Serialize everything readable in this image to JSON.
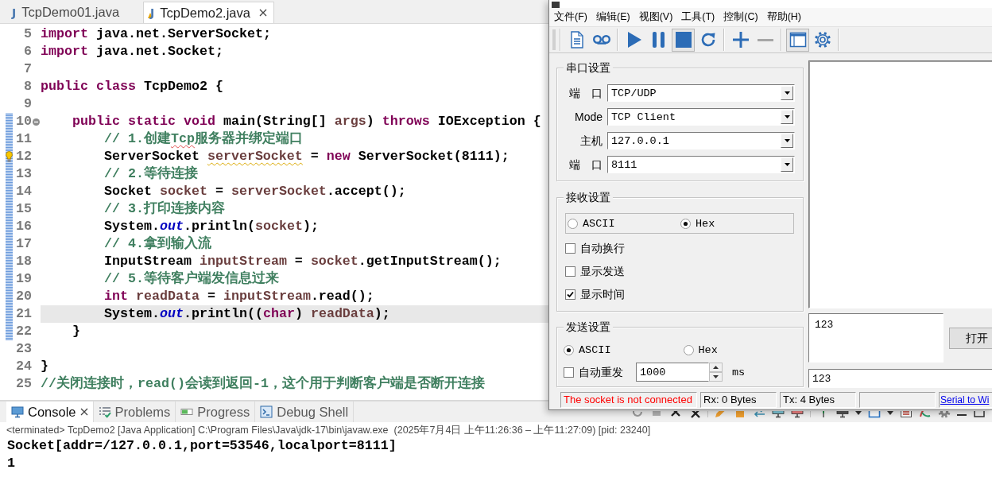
{
  "editor": {
    "tabs": [
      {
        "icon": "J",
        "label": "TcpDemo01.java",
        "selected": false,
        "warning": false
      },
      {
        "icon": "J",
        "label": "TcpDemo2.java",
        "selected": true,
        "warning": true
      }
    ],
    "lines": [
      {
        "number": "5",
        "changed": false,
        "current": false,
        "foldable": false,
        "quick_fix": false,
        "segments": [
          {
            "kind": "keyword",
            "text": "import"
          },
          {
            "kind": "plain",
            "text": " java.net.ServerSocket;"
          }
        ]
      },
      {
        "number": "6",
        "changed": false,
        "current": false,
        "foldable": false,
        "quick_fix": false,
        "segments": [
          {
            "kind": "keyword",
            "text": "import"
          },
          {
            "kind": "plain",
            "text": " java.net.Socket;"
          }
        ]
      },
      {
        "number": "7",
        "changed": false,
        "current": false,
        "foldable": false,
        "quick_fix": false
      },
      {
        "number": "8",
        "changed": false,
        "current": false,
        "foldable": false,
        "quick_fix": false,
        "segments": [
          {
            "kind": "keyword",
            "text": "public class"
          },
          {
            "kind": "plain",
            "text": " TcpDemo2 {"
          }
        ]
      },
      {
        "number": "9",
        "changed": false,
        "current": false,
        "foldable": false,
        "quick_fix": false
      },
      {
        "number": "10",
        "changed": true,
        "current": false,
        "foldable": true,
        "quick_fix": false,
        "segments": [
          {
            "kind": "keyword",
            "text": "    public static void"
          },
          {
            "kind": "plain",
            "text": " main(String[] "
          },
          {
            "kind": "local",
            "text": "args"
          },
          {
            "kind": "plain",
            "text": ") "
          },
          {
            "kind": "keyword",
            "text": "throws"
          },
          {
            "kind": "plain",
            "text": " IOException {"
          }
        ]
      },
      {
        "number": "11",
        "changed": true,
        "current": false,
        "foldable": false,
        "quick_fix": false,
        "segments": [
          {
            "kind": "comment",
            "text": "        // 1.创建"
          },
          {
            "kind": "misspelled",
            "text": "Tcp"
          },
          {
            "kind": "comment",
            "text": "服务器并绑定端口"
          }
        ]
      },
      {
        "number": "12",
        "changed": true,
        "current": false,
        "foldable": false,
        "quick_fix": true,
        "segments": [
          {
            "kind": "plain",
            "text": "        ServerSocket "
          },
          {
            "kind": "unused",
            "text": "serverSocket"
          },
          {
            "kind": "plain",
            "text": " = "
          },
          {
            "kind": "keyword",
            "text": "new"
          },
          {
            "kind": "plain",
            "text": " ServerSocket(8111);"
          }
        ]
      },
      {
        "number": "13",
        "changed": true,
        "current": false,
        "foldable": false,
        "quick_fix": false,
        "segments": [
          {
            "kind": "comment",
            "text": "        // 2.等待连接"
          }
        ]
      },
      {
        "number": "14",
        "changed": true,
        "current": false,
        "foldable": false,
        "quick_fix": false,
        "segments": [
          {
            "kind": "plain",
            "text": "        Socket "
          },
          {
            "kind": "local",
            "text": "socket"
          },
          {
            "kind": "plain",
            "text": " = "
          },
          {
            "kind": "local",
            "text": "serverSocket"
          },
          {
            "kind": "plain",
            "text": ".accept();"
          }
        ]
      },
      {
        "number": "15",
        "changed": true,
        "current": false,
        "foldable": false,
        "quick_fix": false,
        "segments": [
          {
            "kind": "comment",
            "text": "        // 3.打印连接内容"
          }
        ]
      },
      {
        "number": "16",
        "changed": true,
        "current": false,
        "foldable": false,
        "quick_fix": false,
        "segments": [
          {
            "kind": "plain",
            "text": "        System."
          },
          {
            "kind": "field",
            "text": "out"
          },
          {
            "kind": "plain",
            "text": ".println("
          },
          {
            "kind": "local",
            "text": "socket"
          },
          {
            "kind": "plain",
            "text": ");"
          }
        ]
      },
      {
        "number": "17",
        "changed": true,
        "current": false,
        "foldable": false,
        "quick_fix": false,
        "segments": [
          {
            "kind": "comment",
            "text": "        // 4.拿到输入流"
          }
        ]
      },
      {
        "number": "18",
        "changed": true,
        "current": false,
        "foldable": false,
        "quick_fix": false,
        "segments": [
          {
            "kind": "plain",
            "text": "        InputStream "
          },
          {
            "kind": "local",
            "text": "inputStream"
          },
          {
            "kind": "plain",
            "text": " = "
          },
          {
            "kind": "local",
            "text": "socket"
          },
          {
            "kind": "plain",
            "text": ".getInputStream();"
          }
        ]
      },
      {
        "number": "19",
        "changed": true,
        "current": false,
        "foldable": false,
        "quick_fix": false,
        "segments": [
          {
            "kind": "comment",
            "text": "        // 5.等待客户端发信息过来"
          }
        ]
      },
      {
        "number": "20",
        "changed": true,
        "current": false,
        "foldable": false,
        "quick_fix": false,
        "segments": [
          {
            "kind": "keyword",
            "text": "        int"
          },
          {
            "kind": "local",
            "text": " readData"
          },
          {
            "kind": "plain",
            "text": " = "
          },
          {
            "kind": "local",
            "text": "inputStream"
          },
          {
            "kind": "plain",
            "text": ".read();"
          }
        ]
      },
      {
        "number": "21",
        "changed": true,
        "current": true,
        "foldable": false,
        "quick_fix": false,
        "segments": [
          {
            "kind": "plain",
            "text": "        System."
          },
          {
            "kind": "field",
            "text": "out"
          },
          {
            "kind": "plain",
            "text": ".println(("
          },
          {
            "kind": "keyword",
            "text": "char"
          },
          {
            "kind": "plain",
            "text": ") "
          },
          {
            "kind": "local",
            "text": "readData"
          },
          {
            "kind": "plain",
            "text": ");"
          }
        ]
      },
      {
        "number": "22",
        "changed": true,
        "current": false,
        "foldable": false,
        "quick_fix": false,
        "segments": [
          {
            "kind": "plain",
            "text": "    }"
          }
        ]
      },
      {
        "number": "23",
        "changed": false,
        "current": false,
        "foldable": false,
        "quick_fix": false
      },
      {
        "number": "24",
        "changed": false,
        "current": false,
        "foldable": false,
        "quick_fix": false,
        "segments": [
          {
            "kind": "plain",
            "text": "}"
          }
        ]
      },
      {
        "number": "25",
        "changed": false,
        "current": false,
        "foldable": false,
        "quick_fix": false,
        "segments": [
          {
            "kind": "comment",
            "text": "//关闭连接时，read()会读到返回-1，这个用于判断客户端是否断开连接"
          }
        ]
      }
    ]
  },
  "console": {
    "tabs": [
      {
        "label": "Console",
        "selected": true
      },
      {
        "label": "Problems",
        "selected": false
      },
      {
        "label": "Progress",
        "selected": false
      },
      {
        "label": "Debug Shell",
        "selected": false
      }
    ],
    "status": "<terminated> TcpDemo2 [Java Application] C:\\Program Files\\Java\\jdk-17\\bin\\javaw.exe  (2025年7月4日 上午11:26:36 – 上午11:27:09) [pid: 23240]",
    "output": [
      "Socket[addr=/127.0.0.1,port=53546,localport=8111]",
      "1"
    ]
  },
  "serial_tool": {
    "menu": [
      "文件(F)",
      "编辑(E)",
      "视图(V)",
      "工具(T)",
      "控制(C)",
      "帮助(H)"
    ],
    "toolbar": [
      {
        "buttons": [
          {
            "pressed": false,
            "disabled": false
          },
          {
            "pressed": false,
            "disabled": false
          }
        ]
      },
      {
        "buttons": [
          {
            "pressed": false,
            "disabled": false
          },
          {
            "pressed": false,
            "disabled": false
          },
          {
            "pressed": true,
            "disabled": false
          },
          {
            "pressed": false,
            "disabled": false
          }
        ]
      },
      {
        "buttons": [
          {
            "pressed": false,
            "disabled": false
          },
          {
            "pressed": false,
            "disabled": true
          }
        ]
      },
      {
        "buttons": [
          {
            "pressed": true,
            "disabled": false
          },
          {
            "pressed": false,
            "disabled": false
          }
        ]
      }
    ],
    "port_settings": {
      "title": "串口设置",
      "fields": [
        {
          "label": "端　口",
          "value": "TCP/UDP"
        },
        {
          "label": "Mode",
          "value": "TCP Client"
        },
        {
          "label": "主机",
          "value": "127.0.0.1"
        },
        {
          "label": "端　口",
          "value": "8111"
        }
      ]
    },
    "receive_settings": {
      "title": "接收设置",
      "modes": [
        {
          "label": "ASCII",
          "selected": false
        },
        {
          "label": "Hex",
          "selected": true
        }
      ],
      "options": [
        {
          "label": "自动换行",
          "checked": false
        },
        {
          "label": "显示发送",
          "checked": false
        },
        {
          "label": "显示时间",
          "checked": true
        }
      ]
    },
    "send_settings": {
      "title": "发送设置",
      "modes": [
        {
          "label": "ASCII",
          "selected": true
        },
        {
          "label": "Hex",
          "selected": false
        }
      ],
      "auto_resend": {
        "label": "自动重发",
        "checked": false,
        "interval": "1000",
        "unit": "ms"
      }
    },
    "send_text": "123",
    "open_button": "打开",
    "send_line": "123",
    "status_bar": [
      {
        "kind": "error",
        "text": "The socket is not connected"
      },
      {
        "kind": "plain",
        "text": "Rx: 0 Bytes"
      },
      {
        "kind": "plain",
        "text": "Tx: 4 Bytes"
      },
      {
        "kind": "blank"
      },
      {
        "kind": "link",
        "text": "Serial to Wi"
      }
    ]
  }
}
